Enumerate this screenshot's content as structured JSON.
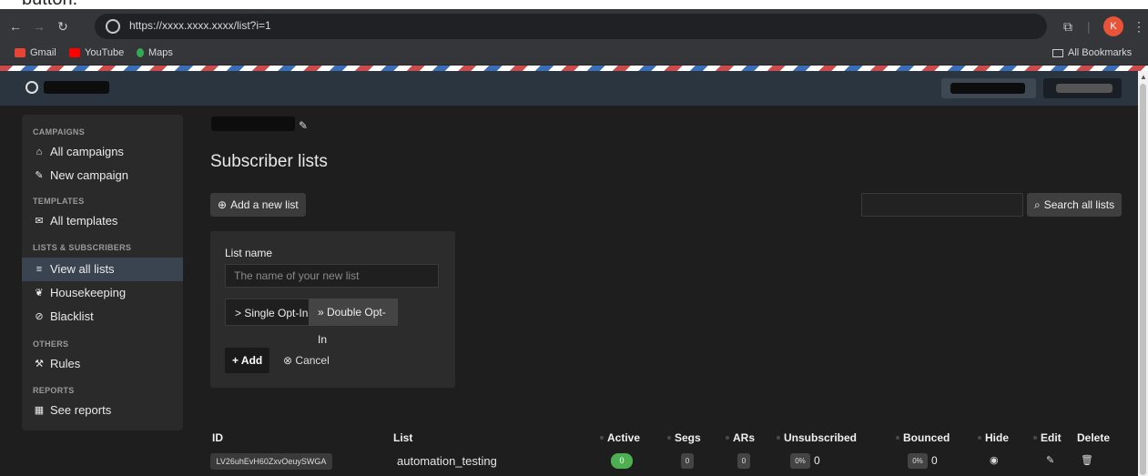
{
  "caption_fragment": "button.",
  "browser": {
    "url": "https://xxxx.xxxx.xxxx/list?i=1",
    "profile_initial": "K",
    "bookmarks": [
      {
        "label": "Gmail",
        "icon": "gmail-icon",
        "color": "#ea4335"
      },
      {
        "label": "YouTube",
        "icon": "youtube-icon",
        "color": "#ff0000"
      },
      {
        "label": "Maps",
        "icon": "maps-icon",
        "color": "#34a853"
      }
    ],
    "all_bookmarks": "All Bookmarks"
  },
  "sidebar": {
    "sections": [
      {
        "heading": "CAMPAIGNS",
        "items": [
          {
            "label": "All campaigns",
            "icon": "home-icon"
          },
          {
            "label": "New campaign",
            "icon": "edit-icon"
          }
        ]
      },
      {
        "heading": "TEMPLATES",
        "items": [
          {
            "label": "All templates",
            "icon": "envelope-icon"
          }
        ]
      },
      {
        "heading": "LISTS & SUBSCRIBERS",
        "items": [
          {
            "label": "View all lists",
            "icon": "list-icon",
            "active": true
          },
          {
            "label": "Housekeeping",
            "icon": "leaf-icon"
          },
          {
            "label": "Blacklist",
            "icon": "ban-icon"
          }
        ]
      },
      {
        "heading": "OTHERS",
        "items": [
          {
            "label": "Rules",
            "icon": "wand-icon"
          }
        ]
      },
      {
        "heading": "REPORTS",
        "items": [
          {
            "label": "See reports",
            "icon": "chart-icon"
          }
        ]
      }
    ]
  },
  "main": {
    "title": "Subscriber lists",
    "add_list_button": "Add a new list",
    "search_button": "Search all lists",
    "search_placeholder": "",
    "form": {
      "label": "List name",
      "placeholder": "The name of your new list",
      "single_optin": "> Single Opt-In",
      "double_optin": "» Double Opt-In",
      "add_button": "Add",
      "cancel_button": "Cancel"
    },
    "table": {
      "headers": [
        "ID",
        "List",
        "Active",
        "Segs",
        "ARs",
        "Unsubscribed",
        "Bounced",
        "Hide",
        "Edit",
        "Delete"
      ],
      "rows": [
        {
          "id": "LV26uhEvH60ZxvOeuySWGA",
          "list": "automation_testing",
          "active": "0",
          "segs": "0",
          "ars": "0",
          "unsub_pct": "0%",
          "unsub": "0",
          "bounced_pct": "0%",
          "bounced": "0"
        }
      ]
    }
  },
  "colors": {
    "active_green": "#4caf50",
    "appbar": "#2b3540",
    "sidebar_active": "#3a4450"
  }
}
